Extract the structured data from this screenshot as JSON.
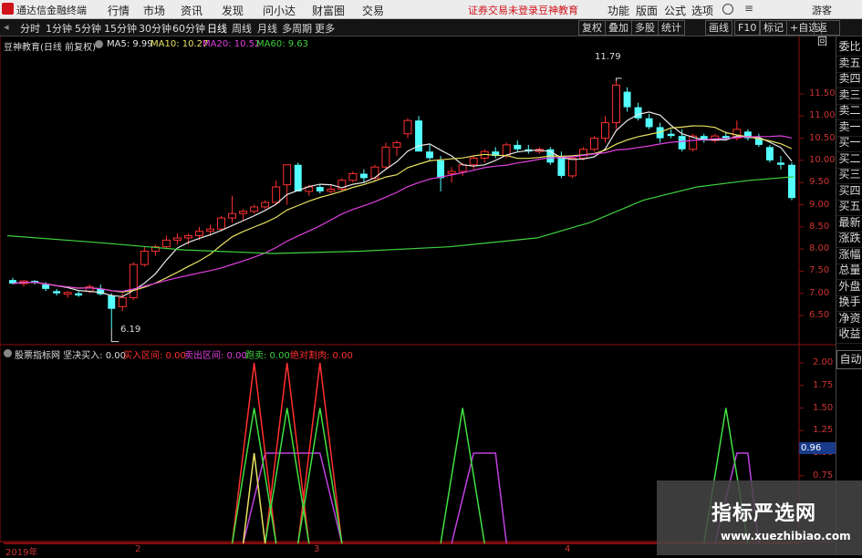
{
  "app": {
    "title": "通达信金融终端",
    "guest": "游客",
    "notice_login": "证券交易未登录",
    "notice_brand": "豆神教育"
  },
  "menu": [
    "行情",
    "市场",
    "资讯",
    "发现",
    "问小达",
    "财富圈",
    "交易"
  ],
  "top_right": [
    "功能",
    "版面",
    "公式",
    "选项"
  ],
  "periods": [
    "分时",
    "1分钟",
    "5分钟",
    "15分钟",
    "30分钟",
    "60分钟",
    "日线",
    "周线",
    "月线",
    "多周期",
    "更多"
  ],
  "toolbar": [
    "复权",
    "叠加",
    "多股",
    "统计",
    "画线",
    "F10",
    "标记",
    "+自选",
    "返回"
  ],
  "main_legend": {
    "stock": "豆神教育(日线 前复权)",
    "ma5": "MA5: 9.99",
    "ma10": "MA10: 10.27",
    "ma20": "MA20: 10.52",
    "ma60": "MA60: 9.63"
  },
  "price_axis": [
    "11.50",
    "11.00",
    "10.50",
    "10.00",
    "9.50",
    "9.00",
    "8.50",
    "8.00",
    "7.50",
    "7.00",
    "6.50"
  ],
  "high_label": "11.79",
  "low_label": "6.19",
  "indicator_legend": {
    "name": "股票指标网 坚决买入: 0.00",
    "buy": "买入区间: 0.00",
    "sell": "卖出区间: 0.00",
    "run": "跑卖: 0.00",
    "abs": "绝对割肉: 0.00"
  },
  "indicator_axis": [
    "2.00",
    "1.75",
    "1.50",
    "1.25",
    "1.00",
    "0.75"
  ],
  "indicator_cursor_value": "0.96",
  "date_axis": [
    "2019年",
    "2",
    "3",
    "4"
  ],
  "side_tabs": [
    "委比",
    "卖五",
    "卖四",
    "卖三",
    "卖二",
    "卖一",
    "买一",
    "买二",
    "买三",
    "买四",
    "买五",
    "最新",
    "涨跌",
    "涨幅",
    "总量",
    "外盘",
    "换手",
    "净资",
    "收益",
    "自动"
  ],
  "colors": {
    "up": "#ff3030",
    "down": "#54ffff",
    "ma5": "#e8e8e8",
    "ma10": "#e8e060",
    "ma20": "#e040e0",
    "ma60": "#40d040"
  },
  "watermark": {
    "title": "指标严选网",
    "url": "www.xuezhibiao.com"
  },
  "chart_data": {
    "type": "candlestick",
    "candles": [
      [
        7.3,
        7.35,
        7.2,
        7.22
      ],
      [
        7.22,
        7.3,
        7.15,
        7.28
      ],
      [
        7.28,
        7.3,
        7.2,
        7.25
      ],
      [
        7.2,
        7.25,
        7.05,
        7.1
      ],
      [
        7.05,
        7.1,
        6.95,
        7.0
      ],
      [
        6.98,
        7.05,
        6.9,
        7.02
      ],
      [
        7.0,
        7.05,
        6.92,
        6.95
      ],
      [
        7.05,
        7.2,
        7.0,
        7.15
      ],
      [
        7.1,
        7.2,
        6.95,
        6.98
      ],
      [
        6.95,
        7.0,
        6.2,
        6.65
      ],
      [
        6.7,
        7.0,
        6.6,
        6.9
      ],
      [
        6.9,
        7.7,
        6.85,
        7.65
      ],
      [
        7.65,
        8.05,
        7.6,
        7.95
      ],
      [
        7.95,
        8.1,
        7.85,
        8.05
      ],
      [
        8.05,
        8.3,
        8.0,
        8.2
      ],
      [
        8.2,
        8.35,
        8.1,
        8.25
      ],
      [
        8.25,
        8.35,
        8.1,
        8.3
      ],
      [
        8.3,
        8.5,
        8.2,
        8.4
      ],
      [
        8.4,
        8.55,
        8.3,
        8.45
      ],
      [
        8.45,
        8.75,
        8.4,
        8.7
      ],
      [
        8.7,
        9.2,
        8.6,
        8.8
      ],
      [
        8.8,
        8.9,
        8.65,
        8.85
      ],
      [
        8.85,
        9.0,
        8.8,
        8.95
      ],
      [
        8.95,
        9.1,
        8.9,
        9.05
      ],
      [
        9.05,
        9.55,
        9.0,
        9.4
      ],
      [
        9.45,
        9.55,
        9.0,
        9.9
      ],
      [
        9.9,
        9.95,
        9.3,
        9.3
      ],
      [
        9.3,
        9.45,
        9.2,
        9.4
      ],
      [
        9.4,
        9.45,
        9.25,
        9.3
      ],
      [
        9.3,
        9.45,
        9.25,
        9.35
      ],
      [
        9.35,
        9.6,
        9.3,
        9.55
      ],
      [
        9.55,
        9.75,
        9.5,
        9.7
      ],
      [
        9.7,
        9.8,
        9.5,
        9.6
      ],
      [
        9.6,
        9.9,
        9.55,
        9.85
      ],
      [
        9.85,
        10.4,
        9.8,
        10.3
      ],
      [
        10.3,
        10.45,
        10.1,
        10.4
      ],
      [
        10.6,
        10.95,
        10.5,
        10.9
      ],
      [
        10.9,
        11.0,
        10.2,
        10.2
      ],
      [
        10.2,
        10.35,
        10.0,
        10.05
      ],
      [
        10.0,
        10.1,
        9.3,
        9.6
      ],
      [
        9.7,
        9.85,
        9.5,
        9.75
      ],
      [
        9.75,
        9.95,
        9.65,
        9.9
      ],
      [
        9.9,
        10.1,
        9.8,
        10.05
      ],
      [
        10.05,
        10.25,
        9.95,
        10.2
      ],
      [
        10.2,
        10.3,
        10.05,
        10.1
      ],
      [
        10.1,
        10.4,
        10.05,
        10.35
      ],
      [
        10.35,
        10.45,
        10.2,
        10.25
      ],
      [
        10.25,
        10.35,
        10.15,
        10.2
      ],
      [
        10.2,
        10.3,
        10.15,
        10.25
      ],
      [
        10.25,
        10.3,
        9.9,
        9.95
      ],
      [
        10.1,
        10.2,
        9.6,
        9.65
      ],
      [
        9.65,
        10.1,
        9.6,
        10.05
      ],
      [
        10.05,
        10.3,
        10.0,
        10.25
      ],
      [
        10.25,
        10.55,
        10.2,
        10.5
      ],
      [
        10.5,
        11.0,
        10.4,
        10.85
      ],
      [
        10.85,
        11.79,
        10.7,
        11.7
      ],
      [
        11.55,
        11.65,
        11.1,
        11.2
      ],
      [
        11.2,
        11.3,
        10.9,
        10.95
      ],
      [
        10.95,
        11.05,
        10.7,
        10.75
      ],
      [
        10.75,
        10.85,
        10.4,
        10.5
      ],
      [
        10.6,
        10.7,
        10.5,
        10.55
      ],
      [
        10.55,
        10.7,
        10.2,
        10.25
      ],
      [
        10.25,
        10.6,
        10.2,
        10.55
      ],
      [
        10.55,
        10.6,
        10.4,
        10.45
      ],
      [
        10.45,
        10.6,
        10.4,
        10.55
      ],
      [
        10.55,
        10.65,
        10.45,
        10.5
      ],
      [
        10.5,
        10.9,
        10.45,
        10.7
      ],
      [
        10.65,
        10.7,
        10.45,
        10.5
      ],
      [
        10.5,
        10.6,
        10.3,
        10.35
      ],
      [
        10.3,
        10.35,
        9.95,
        10.0
      ],
      [
        9.95,
        10.1,
        9.8,
        9.9
      ],
      [
        9.9,
        9.95,
        9.1,
        9.15
      ]
    ],
    "ma60": [
      [
        0,
        8.3
      ],
      [
        10,
        8.15
      ],
      [
        20,
        7.98
      ],
      [
        30,
        7.9
      ],
      [
        40,
        7.95
      ],
      [
        50,
        8.05
      ],
      [
        60,
        8.25
      ],
      [
        66,
        8.6
      ],
      [
        72,
        9.1
      ],
      [
        78,
        9.4
      ],
      [
        84,
        9.55
      ],
      [
        89,
        9.63
      ]
    ]
  }
}
